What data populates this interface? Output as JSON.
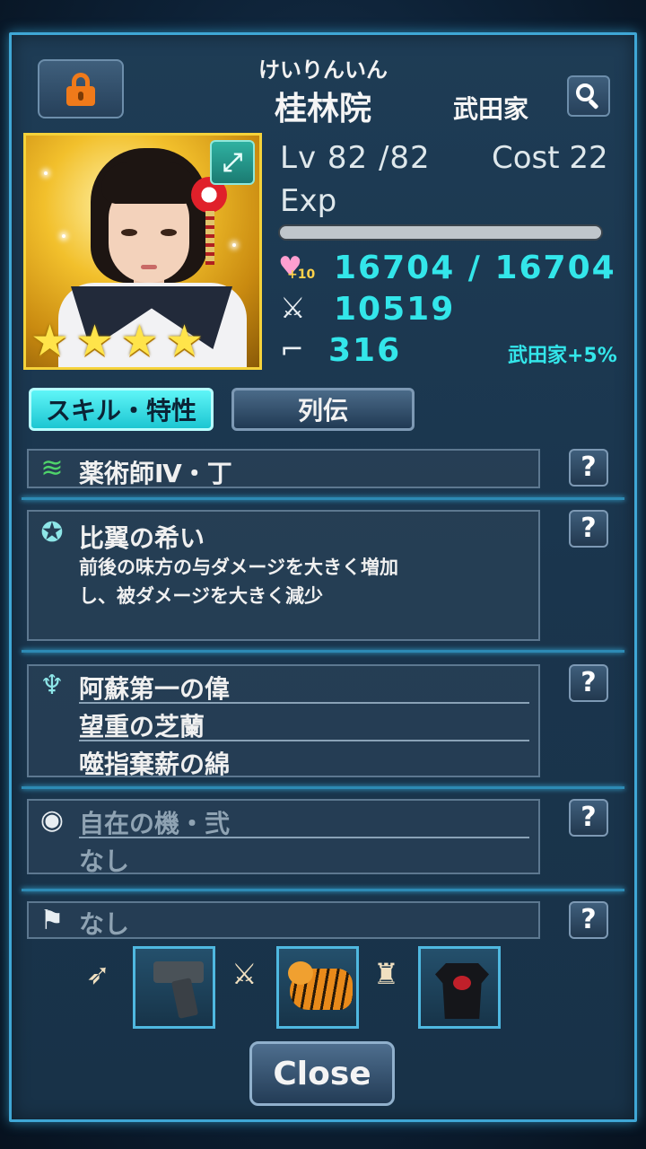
{
  "header": {
    "reading": "けいりんいん",
    "name": "桂林院",
    "clan": "武田家"
  },
  "stats": {
    "lv_label": "Lv 82 /82",
    "cost_label": "Cost 22",
    "exp_label": "Exp",
    "exp_progress": 1.0,
    "hp": "16704 / 16704",
    "hp_bonus": "+10",
    "attack": "10519",
    "speed": "316",
    "bonus": "武田家+5%"
  },
  "rarity_stars": 4,
  "tabs": [
    {
      "label": "スキル・特性",
      "active": true
    },
    {
      "label": "列伝",
      "active": false
    }
  ],
  "sections": {
    "skill": {
      "title": "薬術師Ⅳ・丁",
      "icon": "medicine-icon"
    },
    "active_skill": {
      "title": "比翼の希い",
      "desc_lines": [
        "前後の味方の与ダメージを大きく増加",
        "し、被ダメージを大きく減少"
      ],
      "icon": "pentagram-icon"
    },
    "traits": {
      "items": [
        "阿蘇第一の偉",
        "望重の芝蘭",
        "噬指棄薪の綿"
      ],
      "icon": "person-icon"
    },
    "passive": {
      "items": [
        "自在の機・弐",
        "なし"
      ],
      "icon": "eye-icon"
    },
    "flag": {
      "title": "なし",
      "icon": "flag-icon"
    },
    "help_label": "?"
  },
  "equipment": [
    {
      "slot_icon": "bullet-icon",
      "item": "pistol"
    },
    {
      "slot_icon": "sword-icon",
      "item": "tiger-figure"
    },
    {
      "slot_icon": "armor-icon",
      "item": "t-shirt"
    }
  ],
  "close_label": "Close",
  "colors": {
    "accent": "#33e6ea",
    "frame": "#3fa7d6",
    "lock": "#f07a1a"
  }
}
